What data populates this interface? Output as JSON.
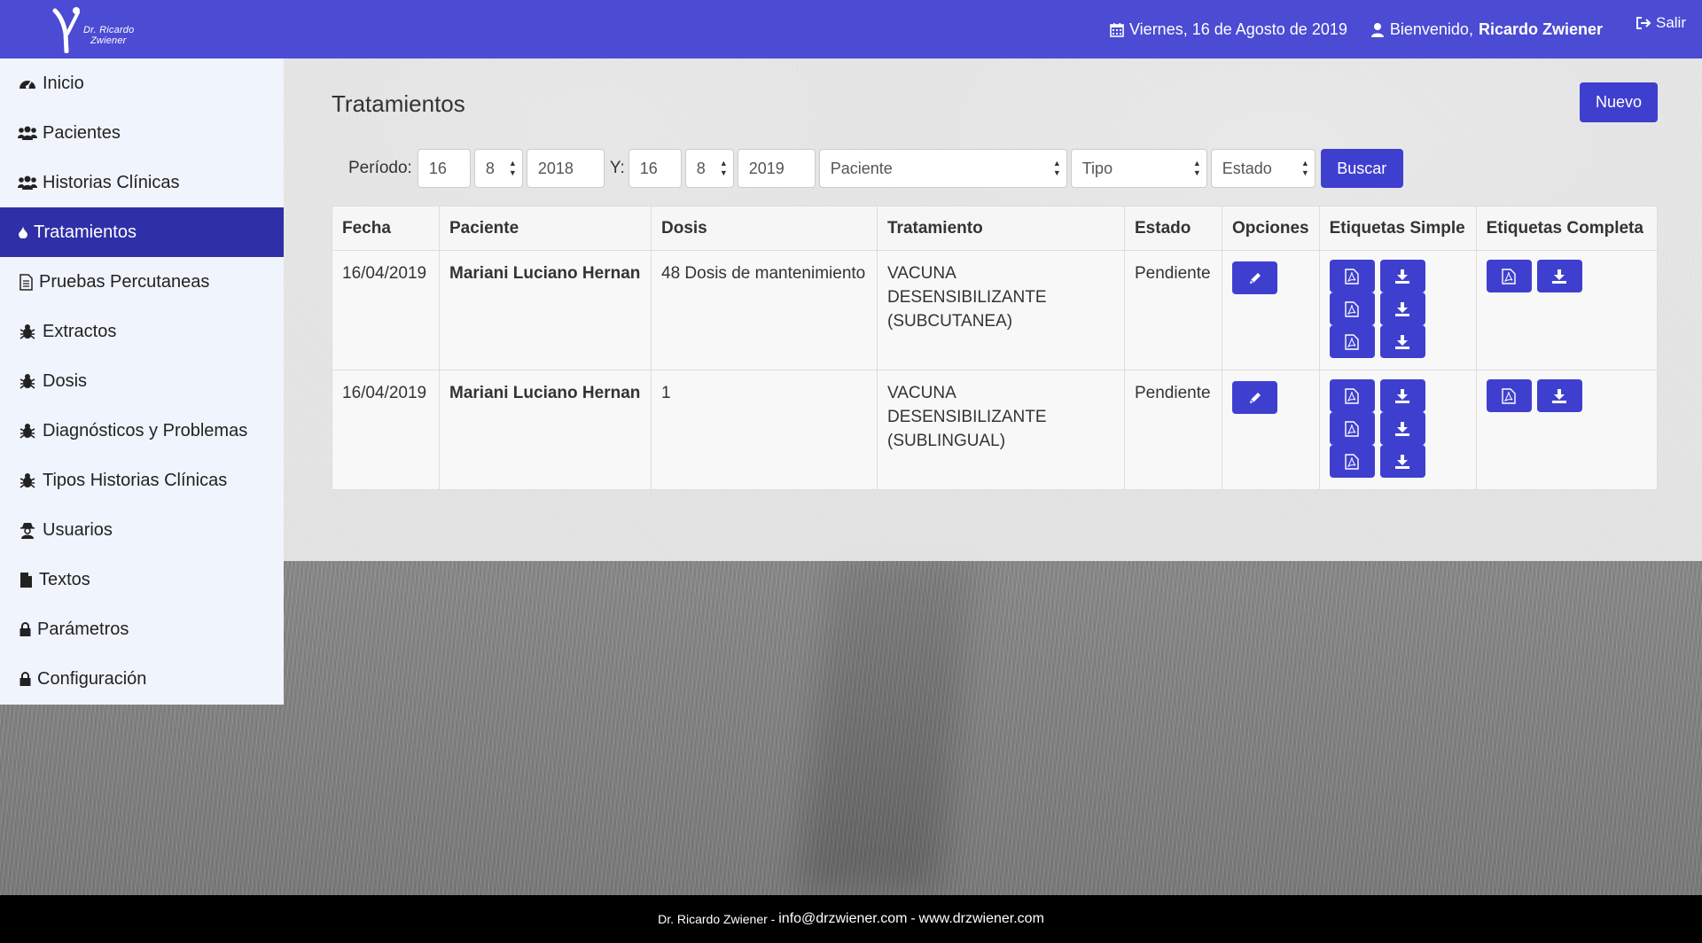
{
  "header": {
    "logo_line1": "Dr. Ricardo",
    "logo_line2": "Zwiener",
    "date": "Viernes, 16 de Agosto de 2019",
    "welcome_prefix": "Bienvenido,",
    "user_name": "Ricardo Zwiener",
    "logout": "Salir"
  },
  "sidebar": {
    "items": [
      {
        "label": "Inicio",
        "icon": "dashboard-icon"
      },
      {
        "label": "Pacientes",
        "icon": "users-icon"
      },
      {
        "label": "Historias Clínicas",
        "icon": "users-icon"
      },
      {
        "label": "Tratamientos",
        "icon": "tint-icon"
      },
      {
        "label": "Pruebas Percutaneas",
        "icon": "file-text-icon"
      },
      {
        "label": "Extractos",
        "icon": "bug-icon"
      },
      {
        "label": "Dosis",
        "icon": "bug-icon"
      },
      {
        "label": "Diagnósticos y Problemas",
        "icon": "bug-icon"
      },
      {
        "label": "Tipos Historias Clínicas",
        "icon": "bug-icon"
      },
      {
        "label": "Usuarios",
        "icon": "user-secret-icon"
      },
      {
        "label": "Textos",
        "icon": "file-icon"
      },
      {
        "label": "Parámetros",
        "icon": "lock-icon"
      },
      {
        "label": "Configuración",
        "icon": "lock-icon"
      }
    ],
    "active_index": 3
  },
  "main": {
    "title": "Tratamientos",
    "new_button": "Nuevo"
  },
  "filters": {
    "period_label": "Período:",
    "from_day": "16",
    "from_month": "8",
    "from_year": "2018",
    "and_label": "Y:",
    "to_day": "16",
    "to_month": "8",
    "to_year": "2019",
    "patient_select": "Paciente",
    "type_select": "Tipo",
    "state_select": "Estado",
    "search_button": "Buscar"
  },
  "table": {
    "headers": [
      "Fecha",
      "Paciente",
      "Dosis",
      "Tratamiento",
      "Estado",
      "Opciones",
      "Etiquetas Simple",
      "Etiquetas Completa"
    ],
    "rows": [
      {
        "fecha": "16/04/2019",
        "paciente": "Mariani Luciano Hernan",
        "dosis": "48 Dosis de mantenimiento",
        "tratamiento": "VACUNA DESENSIBILIZANTE (SUBCUTANEA)",
        "estado": "Pendiente"
      },
      {
        "fecha": "16/04/2019",
        "paciente": "Mariani Luciano Hernan",
        "dosis": "1",
        "tratamiento": "VACUNA DESENSIBILIZANTE (SUBLINGUAL)",
        "estado": "Pendiente"
      }
    ]
  },
  "footer": {
    "name": "Dr. Ricardo Zwiener -",
    "email": "info@drzwiener.com",
    "sep": "-",
    "web": "www.drzwiener.com"
  },
  "colors": {
    "primary": "#4b4bd4",
    "button": "#3f3fcf",
    "active_sidebar": "#2f2fa8"
  }
}
